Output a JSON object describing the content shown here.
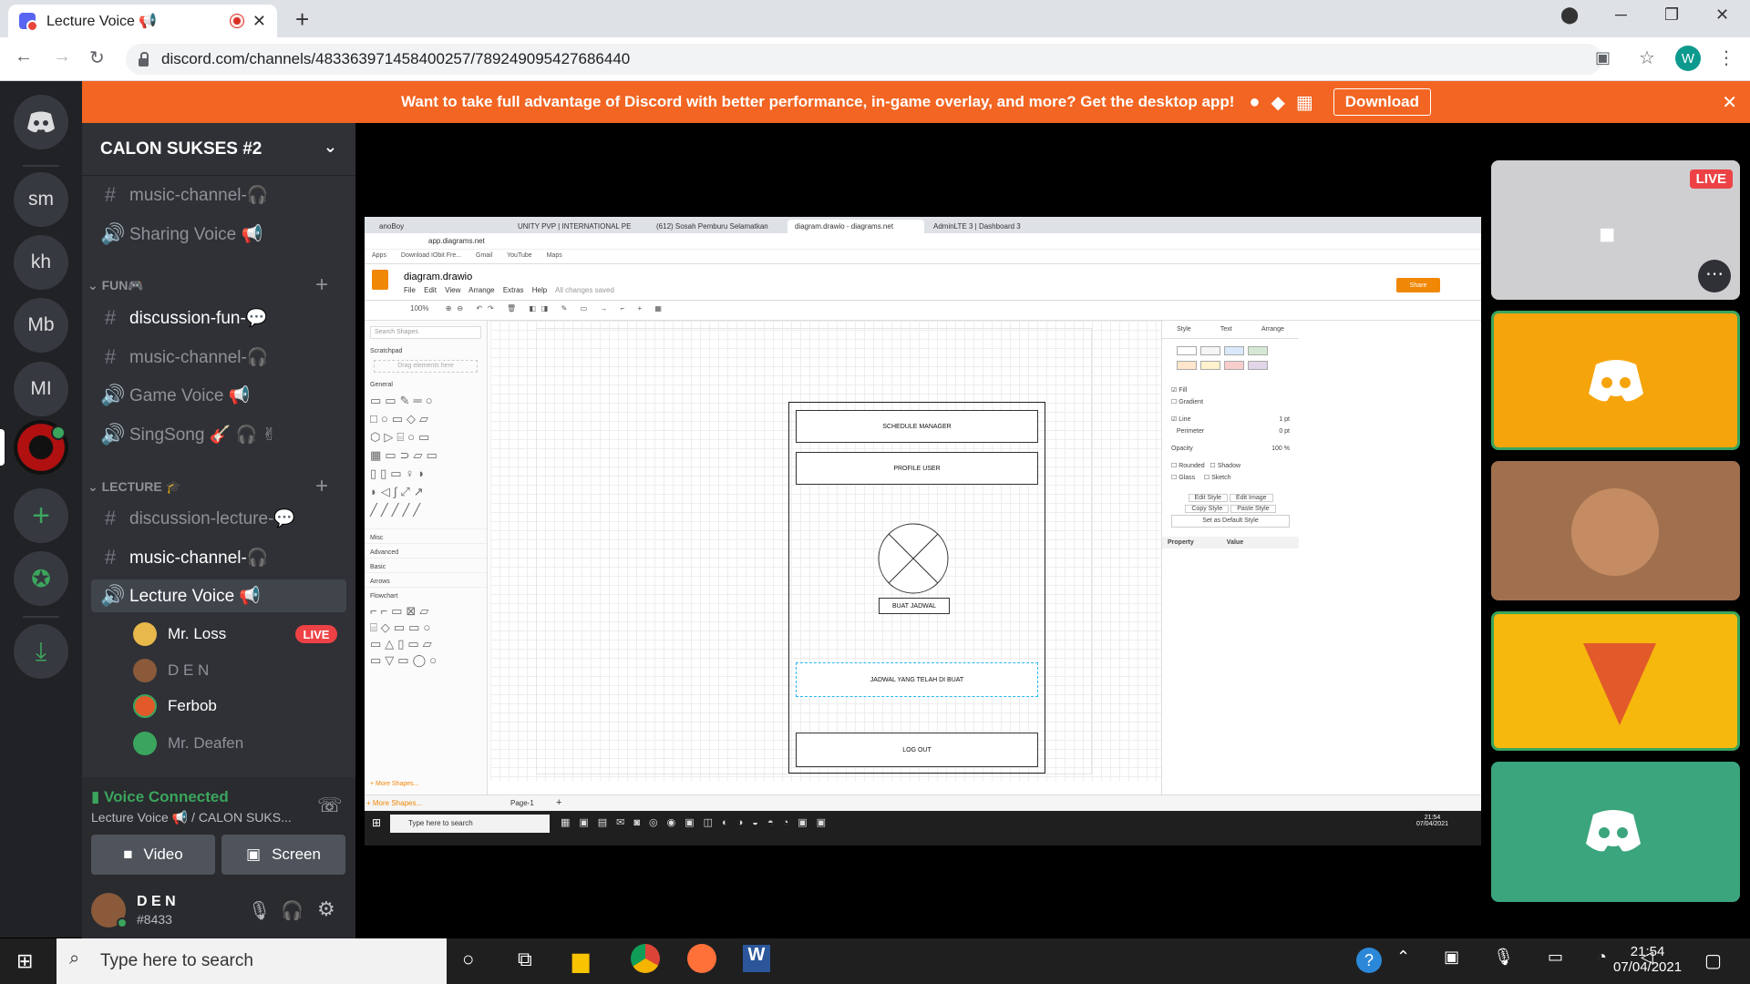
{
  "browser": {
    "tab_title": "Lecture Voice 📢",
    "new_tab": "+",
    "url": "discord.com/channels/483363971458400257/789249095427686440",
    "profile_initial": "W"
  },
  "banner": {
    "text": "Want to take full advantage of Discord with better performance, in-game overlay, and more? Get the desktop app!",
    "download_label": "Download",
    "close": "✕"
  },
  "guilds": [
    "sm",
    "kh",
    "Mb",
    "MI"
  ],
  "server": {
    "name": "CALON SUKSES #2"
  },
  "channels": {
    "top": [
      {
        "prefix": "#",
        "name": "music-channel-🎧",
        "bright": false
      },
      {
        "prefix": "🔊",
        "name": "Sharing Voice 📢",
        "bright": false
      }
    ],
    "fun_label": "FUN🎮",
    "fun": [
      {
        "prefix": "#",
        "name": "discussion-fun-💬",
        "bright": true
      },
      {
        "prefix": "#",
        "name": "music-channel-🎧",
        "bright": false
      },
      {
        "prefix": "🔊",
        "name": "Game Voice 📢",
        "bright": false
      },
      {
        "prefix": "🔊",
        "name": "SingSong 🎸 🎧 ✌",
        "bright": false
      }
    ],
    "lecture_label": "LECTURE 🎓",
    "lecture": [
      {
        "prefix": "#",
        "name": "discussion-lecture-💬",
        "bright": false
      },
      {
        "prefix": "#",
        "name": "music-channel-🎧",
        "bright": true
      },
      {
        "prefix": "🔊",
        "name": "Lecture Voice 📢",
        "bright": true
      }
    ]
  },
  "voice_users": [
    {
      "name": "Mr. Loss",
      "live": "LIVE",
      "color": "#e8b84b"
    },
    {
      "name": "D E N",
      "live": "",
      "color": "#8a5a3a"
    },
    {
      "name": "Ferbob",
      "live": "",
      "color": "#e25a2a"
    },
    {
      "name": "Mr. Deafen",
      "live": "",
      "color": "#3ba55d"
    }
  ],
  "voice_status": {
    "title": "Voice Connected",
    "subtitle": "Lecture Voice 📢 / CALON SUKS...",
    "video_label": "Video",
    "screen_label": "Screen"
  },
  "user_panel": {
    "name": "D E N",
    "tag": "#8433"
  },
  "stream": {
    "live_badge": "LIVE",
    "drawio": {
      "tabs": [
        "anoBoy",
        "UNITY PVP | INTERNATIONAL PE",
        "(612) Sosah Pemburu Selamatkan",
        "diagram.drawio - diagrams.net",
        "AdminLTE 3 | Dashboard 3"
      ],
      "address": "app.diagrams.net",
      "bookmarks": [
        "Apps",
        "Download IObit Fre...",
        "Gmail",
        "YouTube",
        "Maps"
      ],
      "file_title": "diagram.drawio",
      "menu": [
        "File",
        "Edit",
        "View",
        "Arrange",
        "Extras",
        "Help",
        "All changes saved"
      ],
      "share": "Share",
      "zoom": "100%",
      "search_shapes": "Search Shapes",
      "scratchpad": "Scratchpad",
      "drag_here": "Drag elements here",
      "sections": [
        "General",
        "Misc",
        "Advanced",
        "Basic",
        "Arrows",
        "Flowchart"
      ],
      "more_shapes": "+ More Shapes...",
      "page_tab": "Page-1",
      "panel_tabs": [
        "Style",
        "Text",
        "Arrange"
      ],
      "props": [
        "Fill",
        "Gradient",
        "Line",
        "Perimeter",
        "Opacity",
        "Rounded",
        "Shadow",
        "Glass",
        "Sketch"
      ],
      "buttons": [
        "Edit Style",
        "Edit Image",
        "Copy Style",
        "Paste Style",
        "Set as Default Style"
      ],
      "prop_header": [
        "Property",
        "Value"
      ],
      "line_width": "1 pt",
      "perimeter_val": "0 pt",
      "opacity_val": "100 %",
      "boxes": {
        "schedule": "SCHEDULE MANAGER",
        "profile": "PROFILE USER",
        "buat": "BUAT JADWAL",
        "jadwal": "JADWAL YANG TELAH DI BUAT",
        "logout": "LOG OUT"
      },
      "taskbar_search": "Type here to search",
      "clock": "21:54",
      "date": "07/04/2021"
    }
  },
  "taskbar": {
    "search": "Type here to search",
    "time": "21:54",
    "date": "07/04/2021"
  }
}
